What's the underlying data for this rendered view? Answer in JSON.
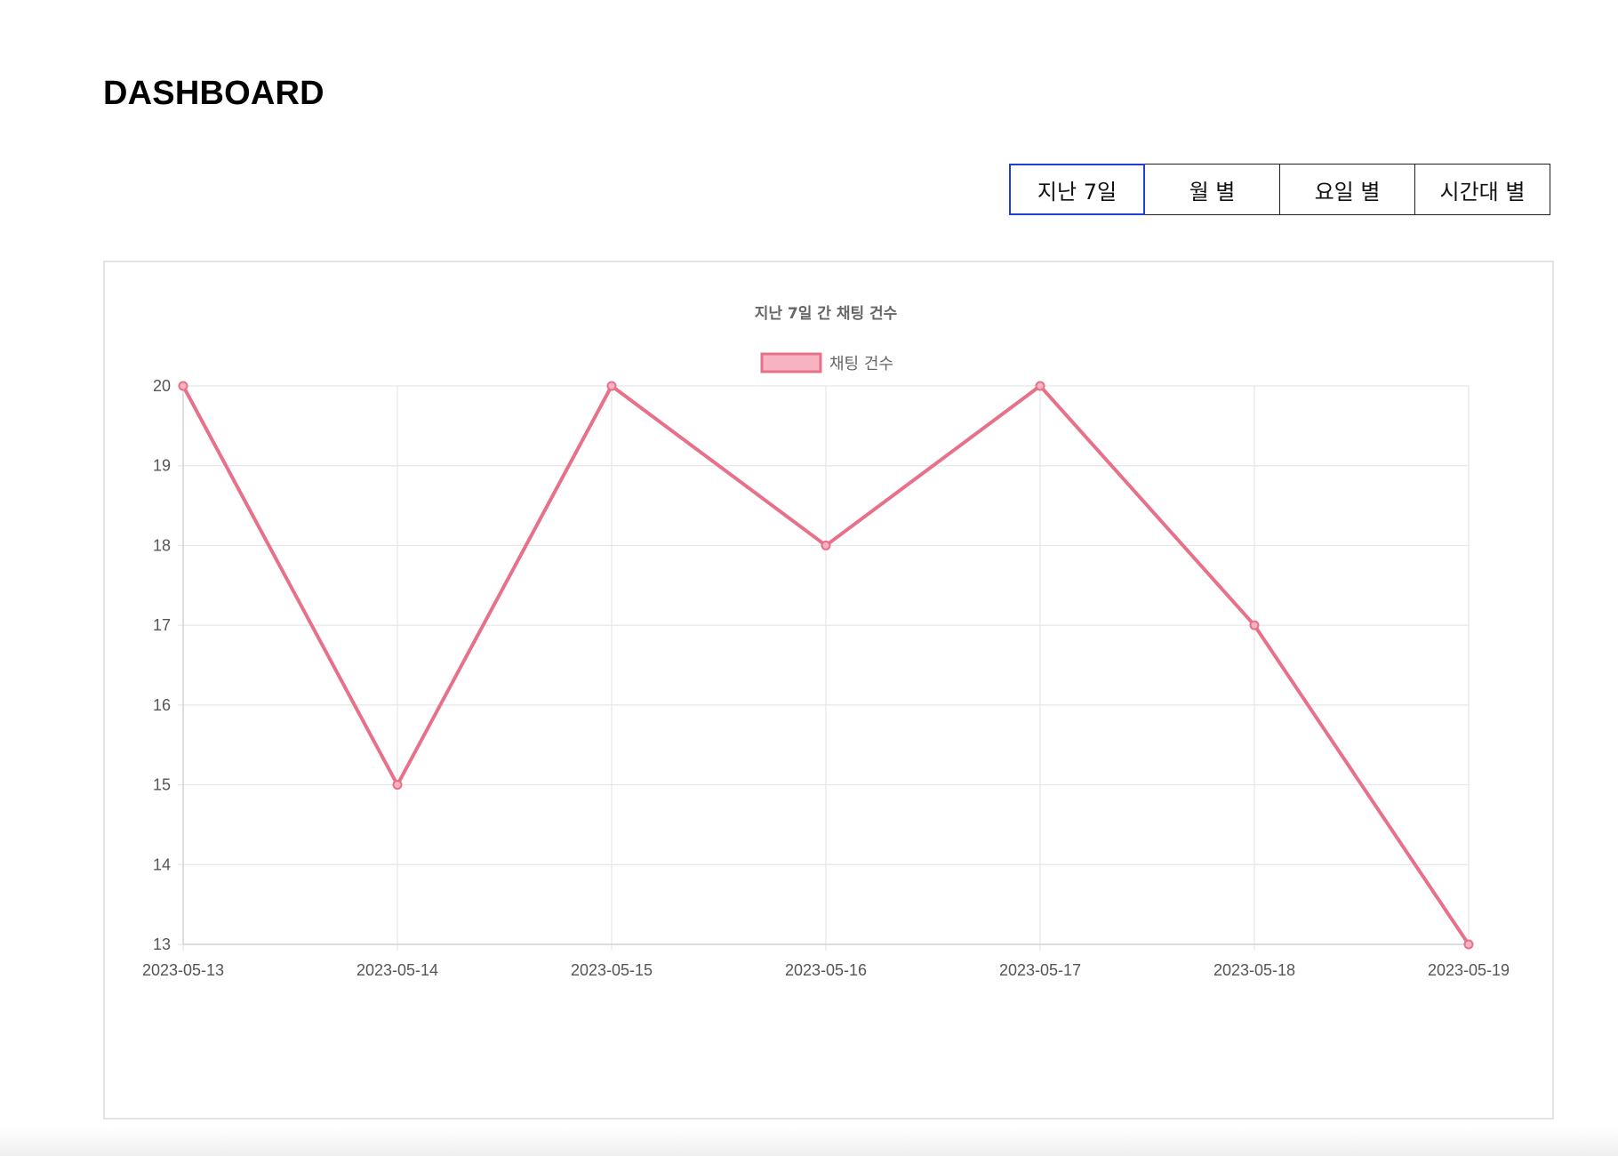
{
  "header": {
    "title": "DASHBOARD"
  },
  "tabs": [
    {
      "label": "지난 7일",
      "active": true
    },
    {
      "label": "월 별",
      "active": false
    },
    {
      "label": "요일 별",
      "active": false
    },
    {
      "label": "시간대 별",
      "active": false
    }
  ],
  "colors": {
    "accent": "#1f3fd8",
    "series_line": "#e8718a",
    "series_fill": "#f7b3c1",
    "grid": "#e6e6e6",
    "tick_text": "#555555"
  },
  "chart_data": {
    "type": "line",
    "title": "지난 7일 간 채팅 건수",
    "x": [
      "2023-05-13",
      "2023-05-14",
      "2023-05-15",
      "2023-05-16",
      "2023-05-17",
      "2023-05-18",
      "2023-05-19"
    ],
    "series": [
      {
        "name": "채팅 건수",
        "values": [
          20,
          15,
          20,
          18,
          20,
          17,
          13
        ]
      }
    ],
    "ylim": [
      13,
      20
    ],
    "yticks": [
      13,
      14,
      15,
      16,
      17,
      18,
      19,
      20
    ],
    "grid": true,
    "legend": "top-center"
  }
}
